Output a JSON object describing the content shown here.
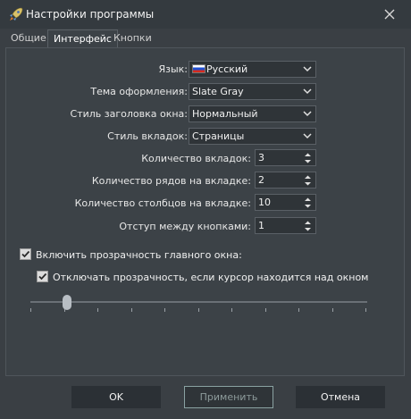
{
  "window": {
    "title": "Настройки программы",
    "close_icon": "close-icon"
  },
  "tabs": [
    {
      "label": "Общие",
      "active": false
    },
    {
      "label": "Интерфейс",
      "active": true
    },
    {
      "label": "Кнопки",
      "active": false
    }
  ],
  "settings": {
    "language": {
      "label": "Язык:",
      "value": "Русский",
      "icon": "russia-flag-icon"
    },
    "theme": {
      "label": "Тема оформления:",
      "value": "Slate Gray"
    },
    "title_style": {
      "label": "Стиль заголовка окна:",
      "value": "Нормальный"
    },
    "tab_style": {
      "label": "Стиль вкладок:",
      "value": "Страницы"
    },
    "tab_count": {
      "label": "Количество вкладок:",
      "value": "3"
    },
    "rows_per_tab": {
      "label": "Количество рядов на вкладке:",
      "value": "2"
    },
    "cols_per_tab": {
      "label": "Количество столбцов на вкладке:",
      "value": "10"
    },
    "button_spacing": {
      "label": "Отступ между кнопками:",
      "value": "1"
    }
  },
  "transparency": {
    "enable_label": "Включить прозрачность главного окна:",
    "enable_checked": true,
    "hover_label": "Отключать прозрачность, если курсор находится над окном",
    "hover_checked": true,
    "level_fraction": 0.11
  },
  "buttons": {
    "ok": "OK",
    "apply": "Применить",
    "cancel": "Отмена"
  },
  "colors": {
    "background": "#3a3f44",
    "titlebar": "#343a3f",
    "button": "#2b3035"
  }
}
